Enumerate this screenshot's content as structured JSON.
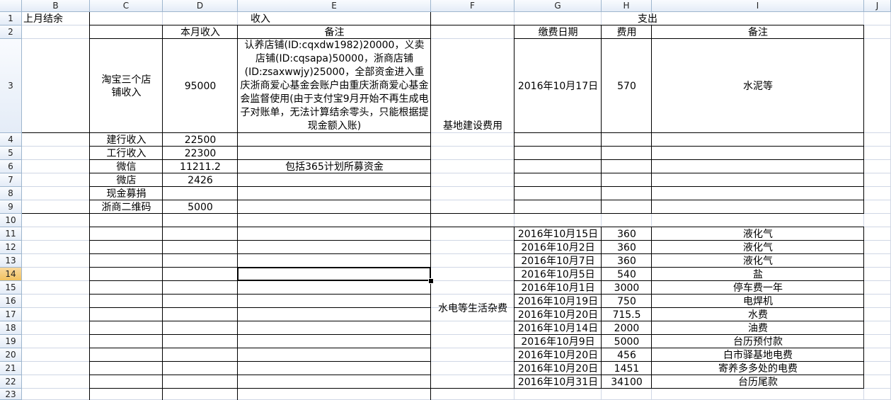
{
  "columns": [
    "B",
    "C",
    "D",
    "E",
    "F",
    "G",
    "H",
    "I",
    "J"
  ],
  "rows": [
    "1",
    "2",
    "3",
    "4",
    "5",
    "6",
    "7",
    "8",
    "9",
    "10",
    "11",
    "12",
    "13",
    "14",
    "15",
    "16",
    "17",
    "18",
    "19",
    "20",
    "21",
    "22",
    "23"
  ],
  "selected_row": "14",
  "headers": {
    "prev_balance": "上月结余",
    "income": "收入",
    "expense": "支出",
    "month_income": "本月收入",
    "income_note": "备注",
    "pay_date": "缴费日期",
    "fee": "费用",
    "expense_note": "备注"
  },
  "income": {
    "taobao_label": "淘宝三个店铺收入",
    "taobao_amount": "95000",
    "taobao_note": "认养店铺(ID:cqxdw1982)20000，义卖店铺(ID:cqsapa)50000，浙商店铺(ID:zsaxwwjy)25000，全部资金进入重庆浙商爱心基金会账户由重庆浙商爱心基金会监督使用(由于支付宝9月开始不再生成电子对账单，无法计算结余零头，只能根据提现金额入账)",
    "rows": [
      {
        "label": "建行收入",
        "amount": "22500",
        "note": ""
      },
      {
        "label": "工行收入",
        "amount": "22300",
        "note": ""
      },
      {
        "label": "微信",
        "amount": "11211.2",
        "note": "包括365计划所募资金"
      },
      {
        "label": "微店",
        "amount": "2426",
        "note": ""
      },
      {
        "label": "现金募捐",
        "amount": "",
        "note": ""
      },
      {
        "label": "浙商二维码",
        "amount": "5000",
        "note": ""
      }
    ]
  },
  "expense": {
    "base_category": "基地建设费用",
    "base_rows": [
      {
        "date": "2016年10月17日",
        "fee": "570",
        "note": "水泥等"
      }
    ],
    "living_category": "水电等生活杂费",
    "living_rows": [
      {
        "date": "2016年10月15日",
        "fee": "360",
        "note": "液化气"
      },
      {
        "date": "2016年10月2日",
        "fee": "360",
        "note": "液化气"
      },
      {
        "date": "2016年10月7日",
        "fee": "360",
        "note": "液化气"
      },
      {
        "date": "2016年10月5日",
        "fee": "540",
        "note": "盐"
      },
      {
        "date": "2016年10月1日",
        "fee": "3000",
        "note": "停车费一年"
      },
      {
        "date": "2016年10月19日",
        "fee": "750",
        "note": "电焊机"
      },
      {
        "date": "2016年10月20日",
        "fee": "715.5",
        "note": "水费"
      },
      {
        "date": "2016年10月14日",
        "fee": "2000",
        "note": "油费"
      },
      {
        "date": "2016年10月9日",
        "fee": "5000",
        "note": "台历预付款"
      },
      {
        "date": "2016年10月20日",
        "fee": "456",
        "note": "白市驿基地电费"
      },
      {
        "date": "2016年10月20日",
        "fee": "1451",
        "note": "寄养多多处的电费"
      },
      {
        "date": "2016年10月31日",
        "fee": "34100",
        "note": "台历尾款"
      }
    ]
  },
  "colors": {
    "header_bg": "#e4ecf7",
    "header_border": "#9eb6ce",
    "gridline": "#d0d7e5",
    "selected_header": "#f1c15f"
  }
}
